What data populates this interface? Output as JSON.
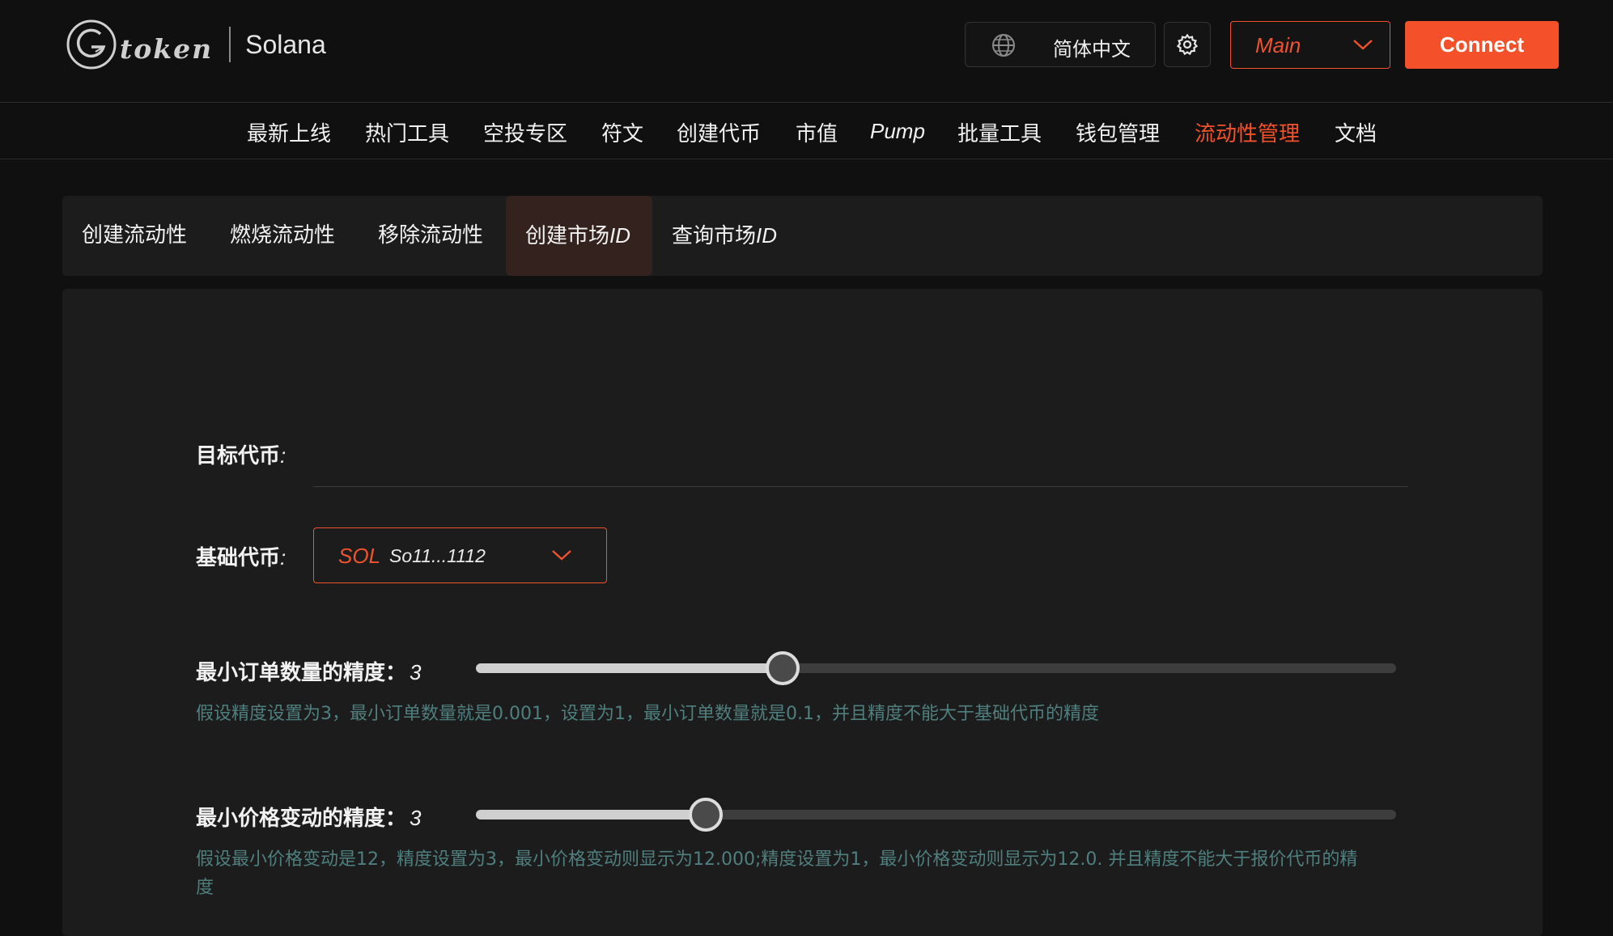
{
  "header": {
    "logo_word": "token",
    "chain": "Solana",
    "language": "简体中文",
    "network": "Main",
    "connect_label": "Connect"
  },
  "main_nav": [
    {
      "label": "最新上线",
      "active": false
    },
    {
      "label": "热门工具",
      "active": false
    },
    {
      "label": "空投专区",
      "active": false
    },
    {
      "label": "符文",
      "active": false
    },
    {
      "label": "创建代币",
      "active": false
    },
    {
      "label": "市值",
      "active": false
    },
    {
      "label": "Pump",
      "active": false
    },
    {
      "label": "批量工具",
      "active": false
    },
    {
      "label": "钱包管理",
      "active": false
    },
    {
      "label": "流动性管理",
      "active": true
    },
    {
      "label": "文档",
      "active": false
    }
  ],
  "sub_tabs": [
    {
      "label": "创建流动性",
      "suffix": "",
      "active": false
    },
    {
      "label": "燃烧流动性",
      "suffix": "",
      "active": false
    },
    {
      "label": "移除流动性",
      "suffix": "",
      "active": false
    },
    {
      "label": "创建市场",
      "suffix": "ID",
      "active": true
    },
    {
      "label": "查询市场",
      "suffix": "ID",
      "active": false
    }
  ],
  "form": {
    "target_token": {
      "label": "目标代币",
      "colon": ":",
      "value": "",
      "placeholder": ""
    },
    "base_token": {
      "label": "基础代币",
      "colon": ":",
      "symbol": "SOL",
      "address": "So11...1112"
    },
    "min_order_precision": {
      "label": "最小订单数量的精度：",
      "value": 3,
      "min": 0,
      "max": 9,
      "hint": "假设精度设置为3，最小订单数量就是0.001，设置为1，最小订单数量就是0.1，并且精度不能大于基础代币的精度"
    },
    "min_price_precision": {
      "label": "最小价格变动的精度：",
      "value": 3,
      "min": 0,
      "max": 12,
      "hint_line1": "假设最小价格变动是12，精度设置为3，最小价格变动则显示为12.000;精度设置为1，最小价格变动则显示为12.0. 并且精度不能大于报价代币的精",
      "hint_line2": "度"
    }
  },
  "colors": {
    "accent": "#f4512b",
    "background": "#101010",
    "panel": "#1c1c1c",
    "hint": "#4f7f7e"
  }
}
